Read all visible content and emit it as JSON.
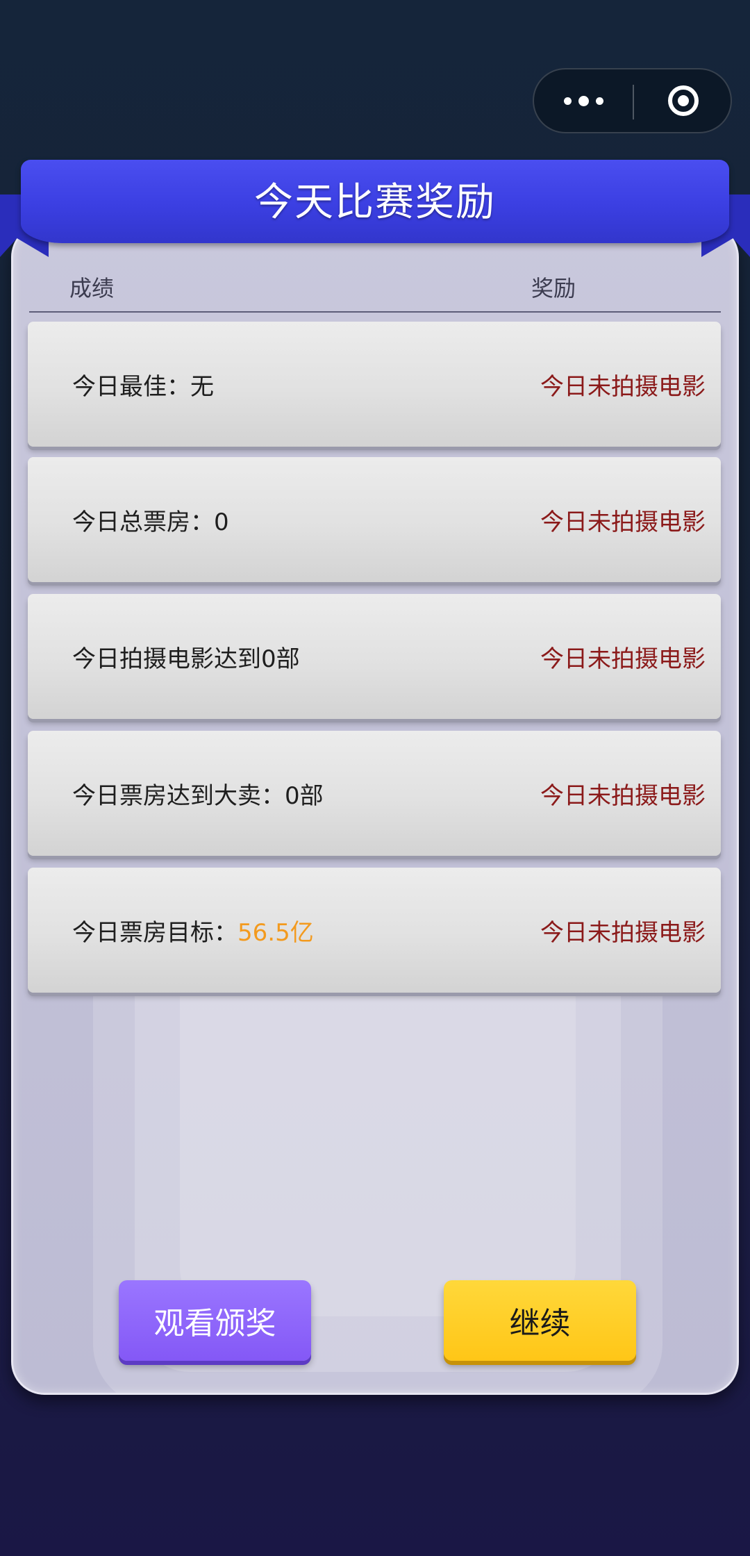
{
  "capsule": {
    "more_icon": "more-dots-icon",
    "close_icon": "target-circle-icon"
  },
  "dialog": {
    "title": "今天比赛奖励",
    "headers": {
      "achievement": "成绩",
      "reward": "奖励"
    },
    "rows": [
      {
        "label": "今日最佳：无",
        "highlight": "",
        "reward": "今日未拍摄电影"
      },
      {
        "label": "今日总票房：0",
        "highlight": "",
        "reward": "今日未拍摄电影"
      },
      {
        "label": "今日拍摄电影达到0部",
        "highlight": "",
        "reward": "今日未拍摄电影"
      },
      {
        "label": "今日票房达到大卖：0部",
        "highlight": "",
        "reward": "今日未拍摄电影"
      },
      {
        "label": "今日票房目标：",
        "highlight": "56.5亿",
        "reward": "今日未拍摄电影"
      }
    ],
    "buttons": {
      "watch_award": "观看颁奖",
      "continue": "继续"
    }
  },
  "colors": {
    "ribbon": "#3b3fe2",
    "reward_text": "#8b1a1a",
    "highlight": "#f39a1e",
    "watch_button": "#8a5cf7",
    "continue_button": "#ffc81f"
  }
}
